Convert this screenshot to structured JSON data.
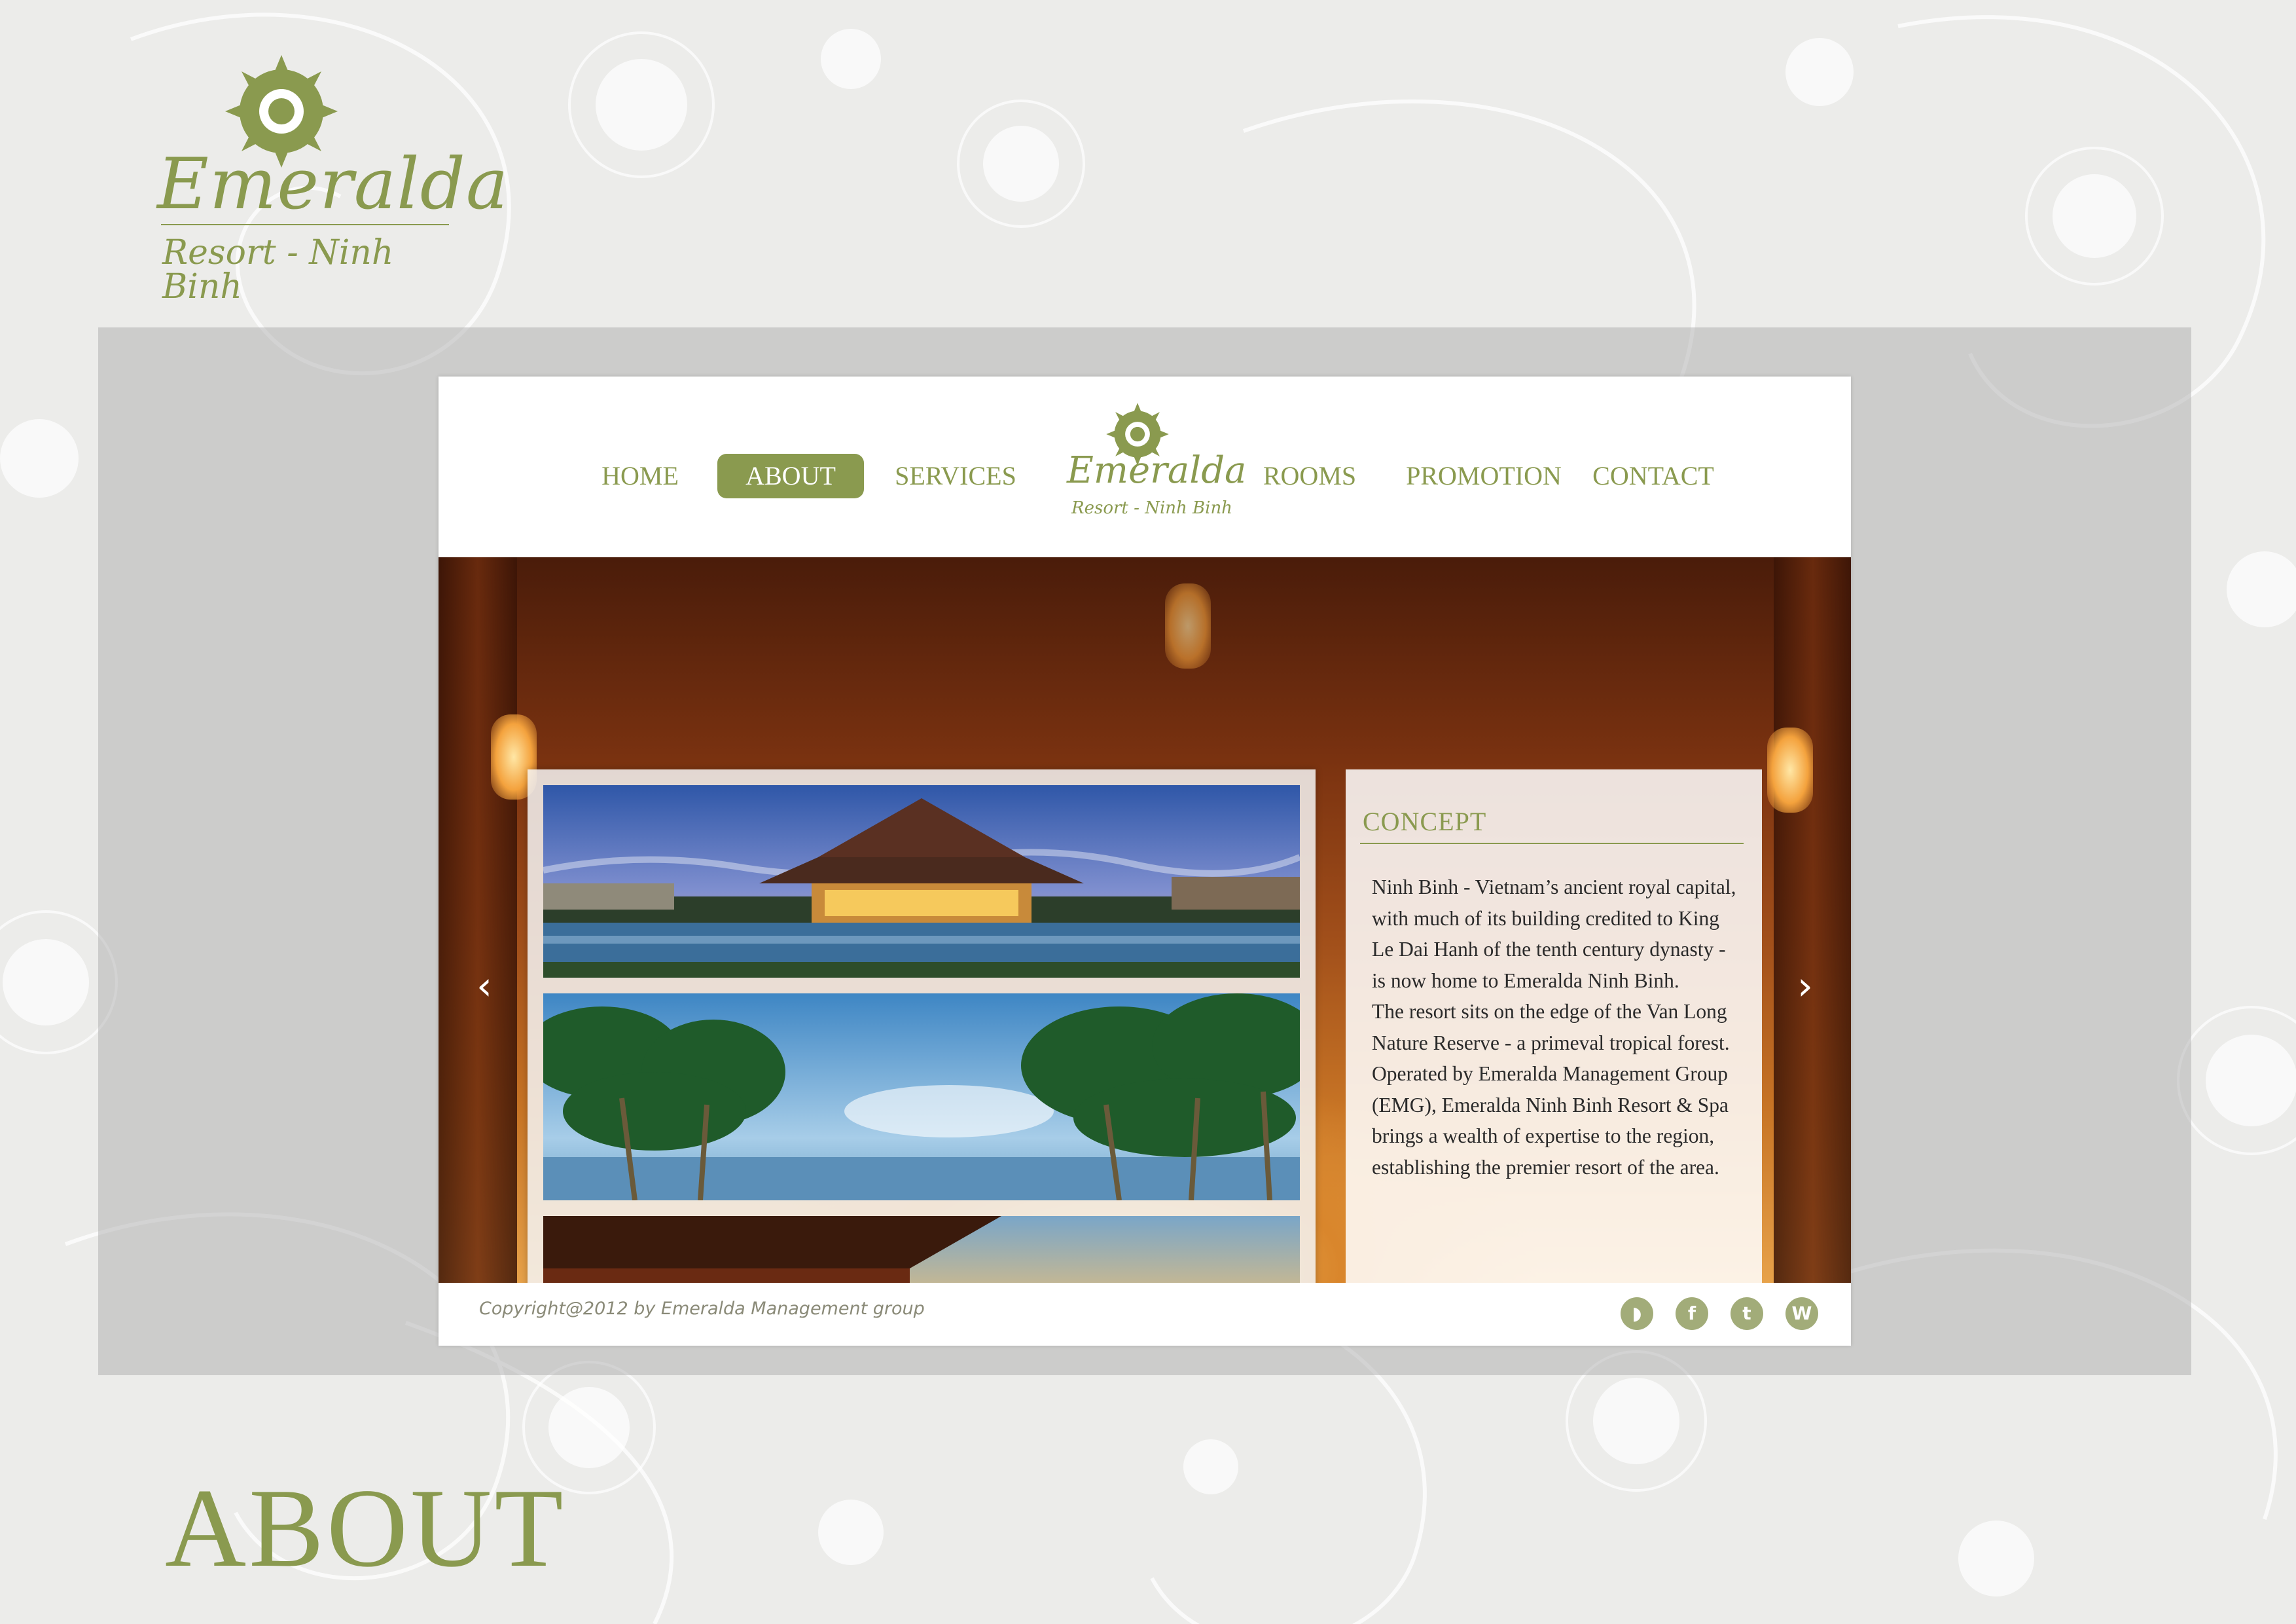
{
  "brand": {
    "name": "Emeralda",
    "subtitle": "Resort - Ninh Binh"
  },
  "nav": {
    "items": [
      {
        "label": "HOME",
        "active": false
      },
      {
        "label": "ABOUT",
        "active": true
      },
      {
        "label": "SERVICES",
        "active": false
      },
      {
        "label": "ROOMS",
        "active": false
      },
      {
        "label": "PROMOTION",
        "active": false
      },
      {
        "label": "CONTACT",
        "active": false
      }
    ],
    "logo": {
      "name": "Emeralda",
      "subtitle": "Resort - Ninh Binh"
    }
  },
  "hero": {
    "prev_icon": "chevron-left-icon",
    "next_icon": "chevron-right-icon",
    "gallery": [
      {
        "name": "temple-photo"
      },
      {
        "name": "palm-trees-photo"
      },
      {
        "name": "sunset-veranda-photo"
      }
    ],
    "concept": {
      "title": "CONCEPT",
      "paragraphs": [
        "Ninh Binh - Vietnam’s ancient royal capital, with much of its building credited to King Le Dai Hanh of the tenth century dynasty - is now home to Emeralda Ninh Binh.",
        "The resort sits on the edge of the Van Long Nature Reserve - a primeval tropical forest.",
        "Operated by Emeralda Management Group (EMG), Emeralda Ninh Binh Resort & Spa brings a wealth of expertise to the region, establishing the premier resort of the area."
      ]
    }
  },
  "footer": {
    "copyright": "Copyright@2012 by Emeralda Management group",
    "social": [
      {
        "icon": "rss-icon",
        "glyph": "◗"
      },
      {
        "icon": "facebook-icon",
        "glyph": "f"
      },
      {
        "icon": "twitter-icon",
        "glyph": "t"
      },
      {
        "icon": "wordpress-icon",
        "glyph": "W"
      }
    ]
  },
  "page_heading": "ABOUT",
  "colors": {
    "accent": "#8a9a4f",
    "panel": "#aaaaaa",
    "text": "#2a2a2a"
  }
}
